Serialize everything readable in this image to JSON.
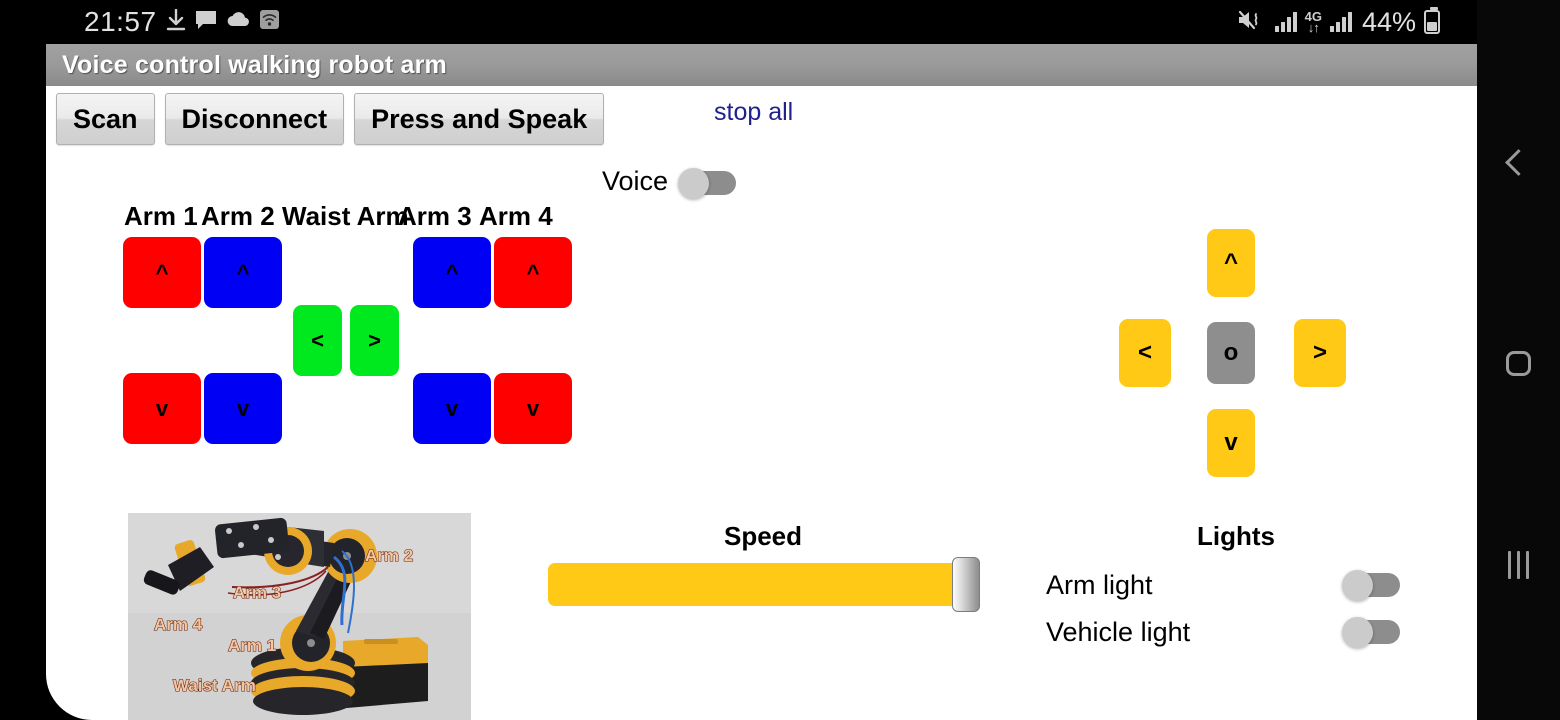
{
  "status_bar": {
    "clock": "21:57",
    "battery_percent": "44%",
    "network_label": "4G",
    "left_icons": [
      "download-icon",
      "message-icon",
      "cloud-icon",
      "wifi-icon"
    ],
    "right_icons": [
      "mute-icon",
      "signal-bars-icon",
      "network-4g-icon",
      "signal-bars-icon",
      "battery-icon"
    ]
  },
  "app": {
    "title": "Voice control walking robot arm",
    "toolbar": {
      "scan": "Scan",
      "disconnect": "Disconnect",
      "press_and_speak": "Press and Speak",
      "voice_label": "Voice",
      "voice_on": false,
      "stop_all": "stop all",
      "stop_all_color": "#20218c"
    },
    "arm_section": {
      "labels": [
        "Arm 1",
        "Arm 2",
        "Waist Arm",
        "Arm 3",
        "Arm 4"
      ],
      "buttons": {
        "arm1_up": "^",
        "arm1_down": "v",
        "arm2_up": "^",
        "arm2_down": "v",
        "waist_left": "<",
        "waist_right": ">",
        "arm3_up": "^",
        "arm3_down": "v",
        "arm4_up": "^",
        "arm4_down": "v"
      },
      "colors": {
        "arm1": "#FF0000",
        "arm2": "#0000F5",
        "waist": "#00E81E",
        "arm3": "#0000F5",
        "arm4": "#FF0000"
      }
    },
    "drive_pad": {
      "up": "^",
      "left": "<",
      "stop": "o",
      "right": ">",
      "down": "v",
      "color": "#FFC915",
      "stop_color": "#8E8E8E"
    },
    "photo": {
      "caption_labels": [
        "Arm 2",
        "Arm 3",
        "Arm 4",
        "Arm 1",
        "Waist Arm"
      ],
      "alt": "robot arm reference photo"
    },
    "speed": {
      "title": "Speed",
      "value_percent": 100,
      "fill_color": "#FFC915"
    },
    "lights": {
      "title": "Lights",
      "items": [
        {
          "label": "Arm light",
          "on": false
        },
        {
          "label": "Vehicle light",
          "on": false
        }
      ]
    }
  },
  "nav_bar": {
    "back": "back-icon",
    "home": "home-icon",
    "recents": "recents-icon"
  }
}
